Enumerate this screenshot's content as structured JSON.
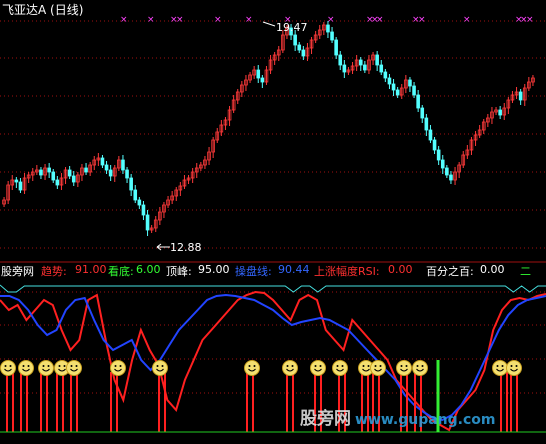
{
  "header": {
    "stock_name": "飞亚达A",
    "period": "(日线)"
  },
  "price_chart": {
    "high_label": "19.47",
    "low_label": "12.88",
    "colors": {
      "up": "#ff3a3a",
      "down": "#54ffff",
      "grid": "#a01010",
      "marker": "#ff44ff"
    }
  },
  "indicator": {
    "name": "股旁网",
    "trend_label": "趋势:",
    "trend_value": "91.00",
    "bottom_label": "看底:",
    "bottom_value": "6.00",
    "peak_label": "顶峰:",
    "peak_value": "95.00",
    "operate_label": "操盘线:",
    "operate_value": "90.44",
    "rsi_label": "上涨幅度RSI:",
    "rsi_value": "0.00",
    "percent_label": "百分之百:",
    "percent_value": "0.00"
  },
  "watermark": {
    "text": "股旁网",
    "site": "www.gupang.com"
  }
}
